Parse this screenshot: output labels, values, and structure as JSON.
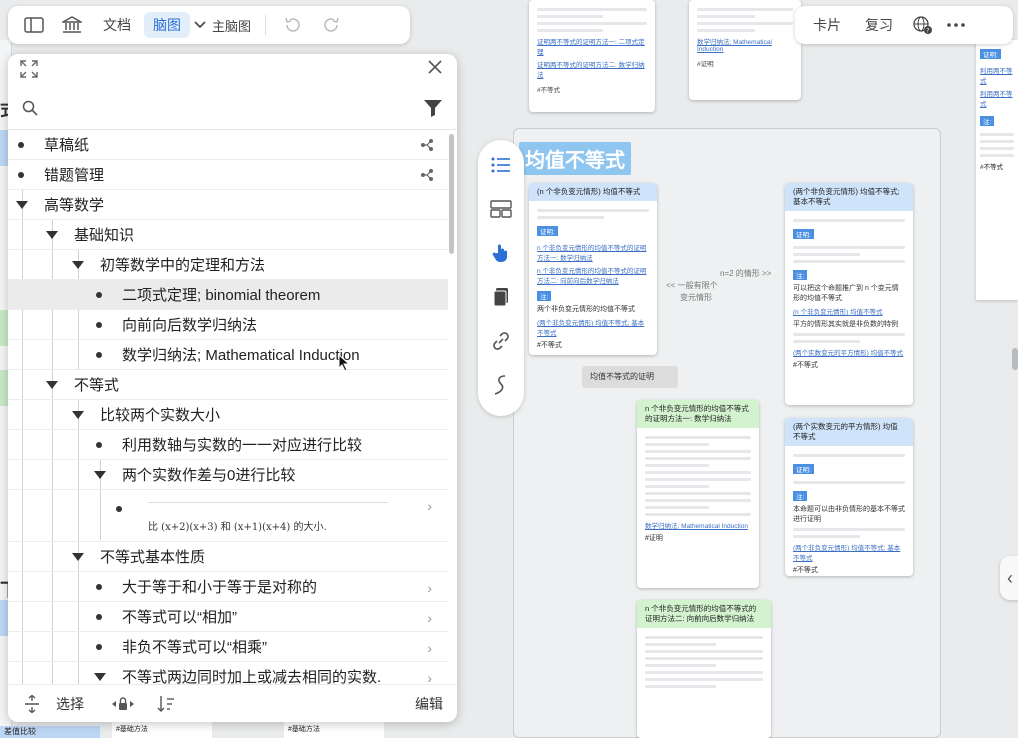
{
  "toolbar": {
    "doc_label": "文档",
    "mindmap_label": "脑图",
    "main_mindmap_label": "主脑图",
    "card_label": "卡片",
    "review_label": "复习"
  },
  "search": {
    "placeholder": ""
  },
  "outline": {
    "items": [
      {
        "label": "草稿纸"
      },
      {
        "label": "错题管理"
      },
      {
        "label": "高等数学"
      },
      {
        "label": "基础知识"
      },
      {
        "label": "初等数学中的定理和方法"
      },
      {
        "label": "二项式定理; binomial theorem"
      },
      {
        "label": "向前向后数学归纳法"
      },
      {
        "label": "数学归纳法; Mathematical Induction"
      },
      {
        "label": "不等式"
      },
      {
        "label": "比较两个实数大小"
      },
      {
        "label": "利用数轴与实数的一一对应进行比较"
      },
      {
        "label": "两个实数作差与0进行比较"
      },
      {
        "label": "不等式基本性质"
      },
      {
        "label": "大于等于和小于等于是对称的"
      },
      {
        "label": "不等式可以“相加”"
      },
      {
        "label": "非负不等式可以“相乘”"
      },
      {
        "label": "不等式两边同时加上或减去相同的实数."
      }
    ],
    "formula_text": "比 (x+2)(x+3) 和 (x+1)(x+4) 的大小."
  },
  "bottom_bar": {
    "select_label": "选择",
    "edit_label": "编辑"
  },
  "canvas": {
    "group_title": "均值不等式",
    "proof_node_label": "均值不等式的证明",
    "edge_label_1": "n=2 的情形 >>",
    "edge_label_2": "<< 一般有限个",
    "edge_label_3": "变元情形",
    "top_card_link_1": "证明两不等式的证明方法一: 二项式定理",
    "top_card_link_2": "证明两不等式的证明方法二: 数学归纳法",
    "top_card_tag": "#不等式",
    "top_card2_link": "数学归纳法; Mathematical Induction",
    "top_card2_tag": "#证明",
    "card_a_title": "(n 个非负变元情形) 均值不等式",
    "card_a_proof": "证明:",
    "card_a_link1": "n 个非负变元情形的均值不等式的证明方法一: 数学归纳法",
    "card_a_link2": "n 个非负变元情形的均值不等式的证明方法二: 向前向后数学归纳法",
    "card_a_note": "注:",
    "card_a_text": "两个非负变元情形的均值不等式",
    "card_a_link3": "(两个非负变元情形) 均值不等式; 基本不等式",
    "card_a_tag": "#不等式",
    "card_b_title": "(两个非负变元情形) 均值不等式; 基本不等式",
    "card_b_proof": "证明:",
    "card_b_note": "注:",
    "card_b_text": "可以把这个命题推广到 n 个变元情形的均值不等式",
    "card_b_link1": "(n 个非负变元情形) 均值不等式",
    "card_b_text2": "平方的情形其实就是非负数的特例",
    "card_b_link2": "(两个实数变元的平方情形) 均值不等式",
    "card_b_tag": "#不等式",
    "card_c_title": "n 个非负变元情形的均值不等式的证明方法一: 数学归纳法",
    "card_c_link": "数学归纳法; Mathematical Induction",
    "card_c_tag": "#证明",
    "card_d_title": "(两个实数变元的平方情形) 均值不等式",
    "card_d_proof": "证明:",
    "card_d_note": "注:",
    "card_d_text": "本命题可以由非负情形的基本不等式进行证明",
    "card_d_link": "(两个非负变元情形) 均值不等式; 基本不等式",
    "card_d_tag": "#不等式",
    "card_e_title": "n 个非负变元情形的均值不等式的证明方法二: 向前向后数学归纳法",
    "bottom_tag_1": "#基础方法",
    "bottom_tag_2": "#基础方法",
    "bottom_left_label": "差值比较",
    "side_card_proof": "证明:",
    "side_card_link1": "利用两不等式",
    "side_card_link2": "利用两不等式",
    "side_card_note": "注:",
    "side_card_tag": "#不等式",
    "left_fragment_1": "式",
    "left_fragment_2": "下"
  }
}
